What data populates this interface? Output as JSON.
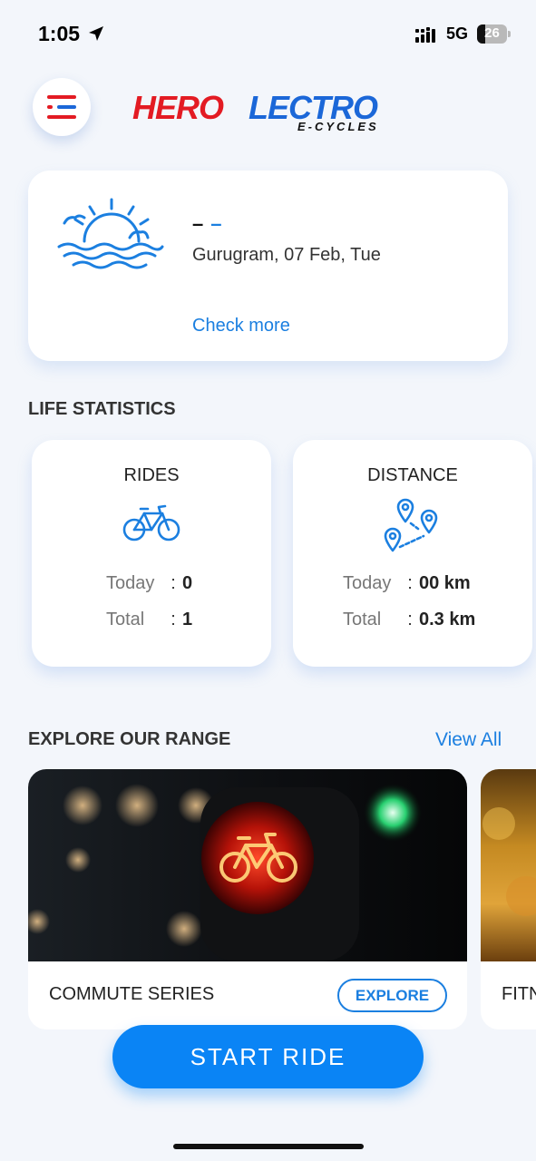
{
  "status_bar": {
    "time": "1:05",
    "network": "5G",
    "battery": "26"
  },
  "header": {
    "logo_part1": "HERO",
    "logo_part2": "LECTRO",
    "logo_sub": "E-CYCLES"
  },
  "weather": {
    "temp_placeholder": "–",
    "unit_placeholder": "–",
    "location_date": "Gurugram, 07 Feb, Tue",
    "check_more": "Check more"
  },
  "life_statistics": {
    "title": "LIFE STATISTICS",
    "rides": {
      "title": "RIDES",
      "today_label": "Today",
      "today_value": "0",
      "total_label": "Total",
      "total_value": "1"
    },
    "distance": {
      "title": "DISTANCE",
      "today_label": "Today",
      "today_value": "00 km",
      "total_label": "Total",
      "total_value": "0.3 km"
    }
  },
  "explore": {
    "title": "EXPLORE OUR RANGE",
    "view_all": "View All",
    "cards": [
      {
        "name": "COMMUTE SERIES",
        "button": "EXPLORE"
      },
      {
        "name": "FITN"
      }
    ]
  },
  "start_ride": "START RIDE",
  "colors": {
    "accent": "#0a84f5",
    "brand_red": "#e31b23",
    "brand_blue": "#1b67d8"
  },
  "icons": [
    "location-arrow-icon",
    "signal-icon",
    "battery-icon",
    "menu-icon",
    "sunrise-icon",
    "bicycle-icon",
    "map-pins-icon"
  ]
}
